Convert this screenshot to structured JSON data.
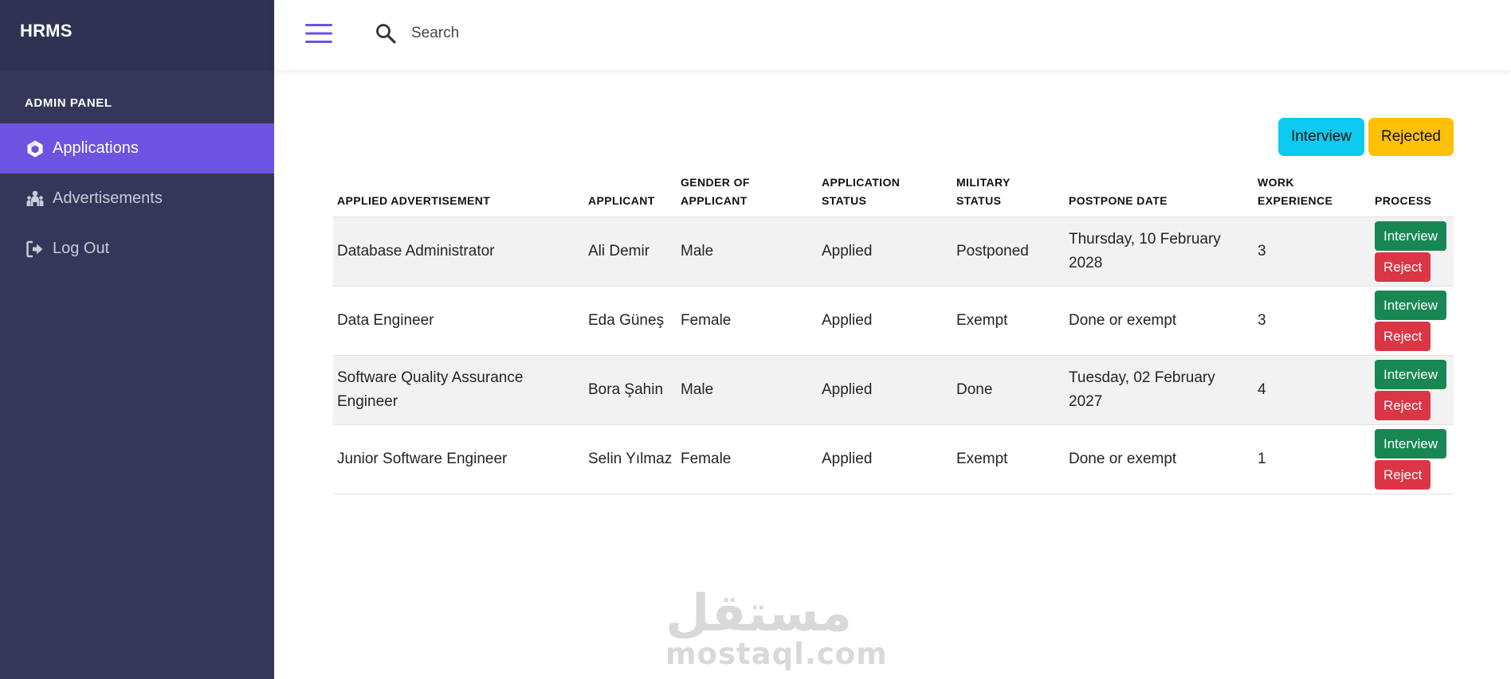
{
  "app": {
    "brand": "HRMS",
    "panel_label": "ADMIN PANEL"
  },
  "sidebar": {
    "items": [
      {
        "label": "Applications",
        "icon": "cube-icon",
        "active": true
      },
      {
        "label": "Advertisements",
        "icon": "people-icon",
        "active": false
      },
      {
        "label": "Log Out",
        "icon": "logout-icon",
        "active": false
      }
    ]
  },
  "topbar": {
    "search_placeholder": "Search"
  },
  "filters": {
    "interview": "Interview",
    "rejected": "Rejected"
  },
  "table": {
    "headers": {
      "advertisement": [
        "APPLIED ADVERTISEMENT"
      ],
      "applicant": [
        "APPLICANT"
      ],
      "gender": [
        "GENDER OF",
        "APPLICANT"
      ],
      "app_status": [
        "APPLICATION",
        "STATUS"
      ],
      "military": [
        "MILITARY",
        "STATUS"
      ],
      "postpone": [
        "POSTPONE DATE"
      ],
      "experience": [
        "WORK",
        "EXPERIENCE"
      ],
      "process": [
        "PROCESS"
      ]
    },
    "rows": [
      {
        "advertisement": "Database Administrator",
        "applicant": "Ali Demir",
        "gender": "Male",
        "status": "Applied",
        "military": "Postponed",
        "postpone": "Thursday, 10 February 2028",
        "experience": "3",
        "interview": "Interview",
        "reject": "Reject"
      },
      {
        "advertisement": "Data Engineer",
        "applicant": "Eda Güneş",
        "gender": "Female",
        "status": "Applied",
        "military": "Exempt",
        "postpone": "Done or exempt",
        "experience": "3",
        "interview": "Interview",
        "reject": "Reject"
      },
      {
        "advertisement": "Software Quality Assurance Engineer",
        "applicant": "Bora Şahin",
        "gender": "Male",
        "status": "Applied",
        "military": "Done",
        "postpone": "Tuesday, 02 February 2027",
        "experience": "4",
        "interview": "Interview",
        "reject": "Reject"
      },
      {
        "advertisement": "Junior Software Engineer",
        "applicant": "Selin Yılmaz",
        "gender": "Female",
        "status": "Applied",
        "military": "Exempt",
        "postpone": "Done or exempt",
        "experience": "1",
        "interview": "Interview",
        "reject": "Reject"
      }
    ]
  },
  "watermark": {
    "arabic": "مستقل",
    "latin": "mostaql.com"
  },
  "colors": {
    "sidebar": "#343759",
    "active": "#6c53e2",
    "interview_filter": "#0dcaf0",
    "rejected_filter": "#ffc107",
    "green": "#198754",
    "red": "#dc3545"
  }
}
